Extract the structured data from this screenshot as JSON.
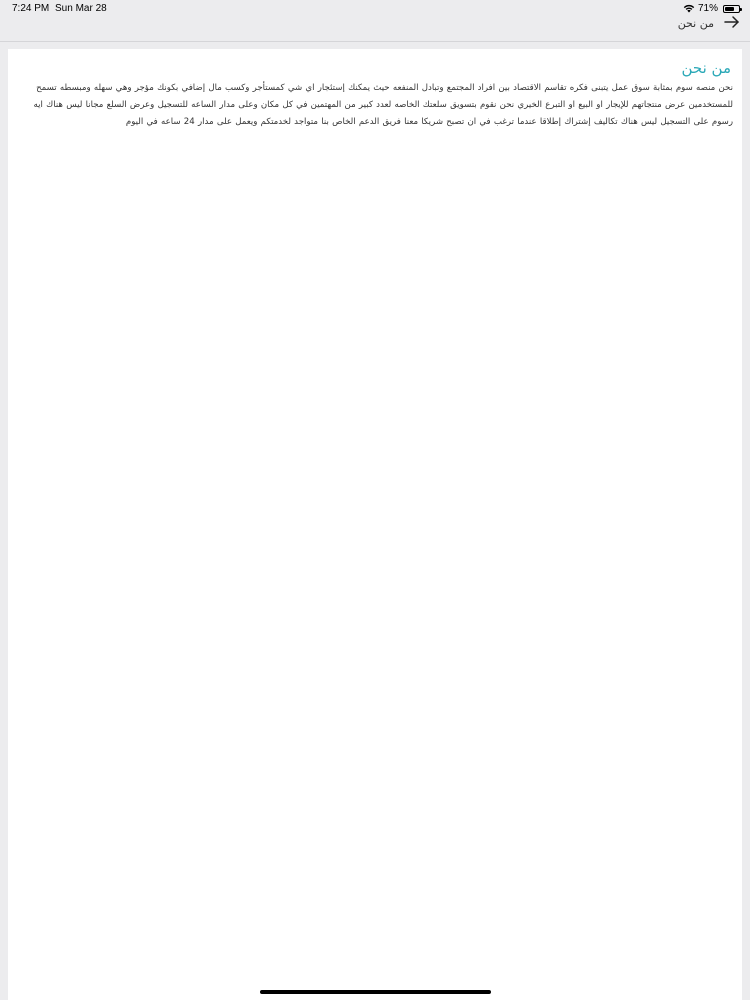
{
  "status_bar": {
    "time": "7:24 PM",
    "date": "Sun Mar 28",
    "battery_percent": "71%",
    "battery_level": 0.71
  },
  "nav": {
    "title": "من نحن",
    "back_icon": "arrow-right-icon"
  },
  "content": {
    "title": "من نحن",
    "body": "نحن منصه سوم بمثابة سوق عمل يتبنى فكره تقاسم الاقتصاد بين افراد المجتمع وتبادل المنفعه حيث يمكنك إستئجار اي شي كمستأجر وكسب مال إضافي بكونك مؤجر وهي سهله ومبسطه تسمح للمستخدمين عرض منتجاتهم للإيجار او البيع او التبرع الخيري نحن نقوم بتسويق سلعتك الخاصه لعدد كبير من المهتمين في كل مكان وعلى مدار الساعه للتسجيل وعرض السلع مجانا ليس هناك ايه رسوم على التسجيل ليس هناك تكاليف إشتراك إطلاقا عندما ترغب في ان تصبح شريكا معنا فريق الدعم الخاص بنا متواجد لخدمتكم ويعمل على مدار 24 ساعه في اليوم"
  },
  "colors": {
    "accent": "#2aa8b7",
    "background": "#ececee",
    "card": "#ffffff"
  }
}
